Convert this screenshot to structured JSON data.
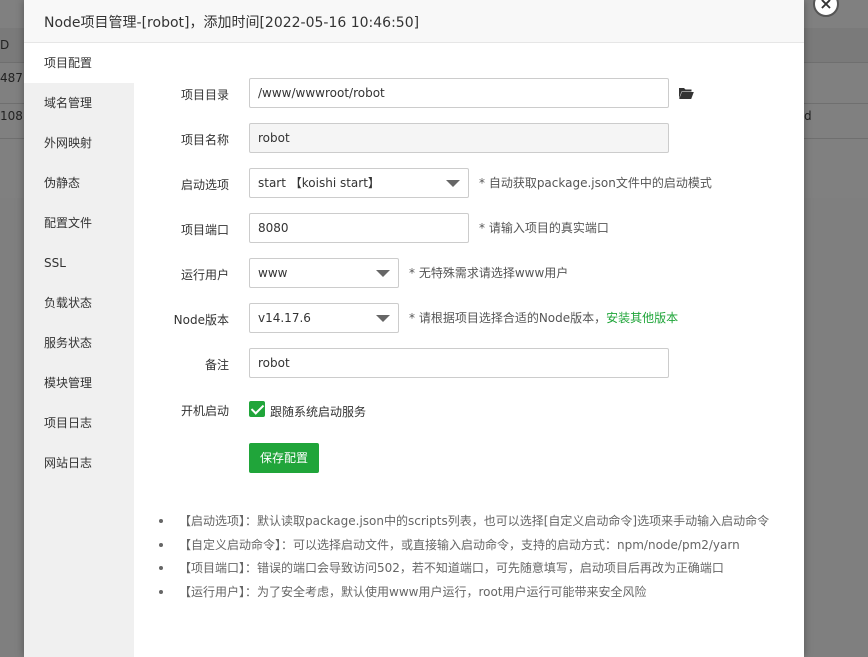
{
  "background": {
    "header_fragment": "D",
    "row1_fragment": "487",
    "row2_fragment": "108",
    "row2_right_fragment": "d"
  },
  "modal": {
    "title": "Node项目管理-[robot]，添加时间[2022-05-16 10:46:50]",
    "close_glyph": "×"
  },
  "sidebar": {
    "items": [
      {
        "label": "项目配置",
        "active": true
      },
      {
        "label": "域名管理",
        "active": false
      },
      {
        "label": "外网映射",
        "active": false
      },
      {
        "label": "伪静态",
        "active": false
      },
      {
        "label": "配置文件",
        "active": false
      },
      {
        "label": "SSL",
        "active": false
      },
      {
        "label": "负载状态",
        "active": false
      },
      {
        "label": "服务状态",
        "active": false
      },
      {
        "label": "模块管理",
        "active": false
      },
      {
        "label": "项目日志",
        "active": false
      },
      {
        "label": "网站日志",
        "active": false
      }
    ]
  },
  "form": {
    "project_dir": {
      "label": "项目目录",
      "value": "/www/wwwroot/robot",
      "icon": "folder-open-icon"
    },
    "project_name": {
      "label": "项目名称",
      "value": "robot"
    },
    "start_option": {
      "label": "启动选项",
      "value": "start 【koishi start】",
      "hint": "* 自动获取package.json文件中的启动模式"
    },
    "project_port": {
      "label": "项目端口",
      "value": "8080",
      "hint": "* 请输入项目的真实端口"
    },
    "run_user": {
      "label": "运行用户",
      "value": "www",
      "hint": "* 无特殊需求请选择www用户"
    },
    "node_version": {
      "label": "Node版本",
      "value": "v14.17.6",
      "hint": "* 请根据项目选择合适的Node版本，",
      "link": "安装其他版本"
    },
    "remark": {
      "label": "备注",
      "value": "robot"
    },
    "autostart": {
      "label": "开机启动",
      "checkbox_label": "跟随系统启动服务",
      "checked": true
    },
    "save_label": "保存配置"
  },
  "notes": [
    "【启动选项】：默认读取package.json中的scripts列表，也可以选择[自定义启动命令]选项来手动输入启动命令",
    "【自定义启动命令】：可以选择启动文件，或直接输入启动命令，支持的启动方式：npm/node/pm2/yarn",
    "【项目端口】：错误的端口会导致访问502，若不知道端口，可先随意填写，启动项目后再改为正确端口",
    "【运行用户】：为了安全考虑，默认使用www用户运行，root用户运行可能带来安全风险"
  ],
  "colors": {
    "accent": "#20a53a",
    "sidebar_bg": "#f0f0f0",
    "overlay": "#7f7f7f"
  }
}
